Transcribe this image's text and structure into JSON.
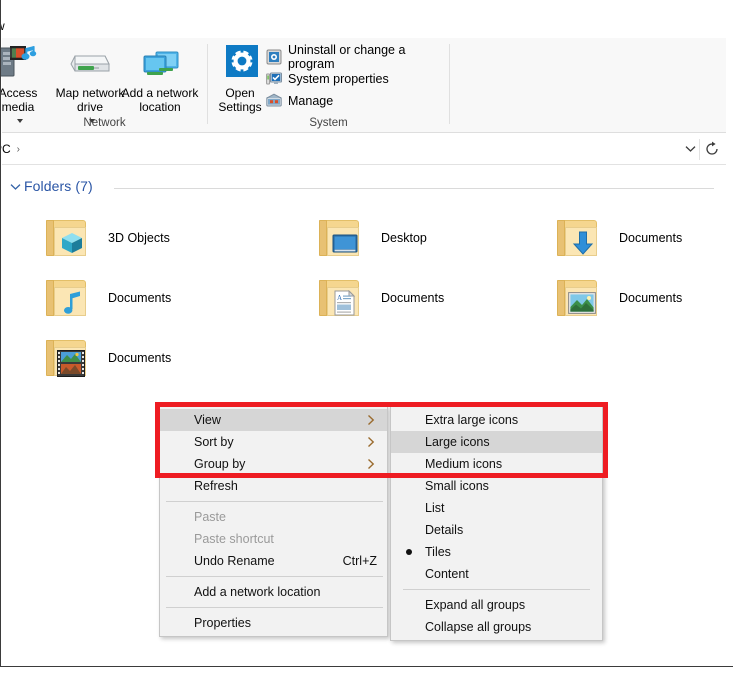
{
  "window": {
    "tab_label": "w"
  },
  "ribbon": {
    "groups": [
      {
        "name": "Network",
        "label": "Network",
        "big_buttons": [
          {
            "icon": "access-media-icon",
            "label": "Access\nmedia",
            "has_dropdown": true
          },
          {
            "icon": "map-network-drive-icon",
            "label": "Map network\ndrive",
            "has_dropdown": true
          },
          {
            "icon": "add-network-location-icon",
            "label": "Add a network\nlocation",
            "has_dropdown": false
          }
        ]
      },
      {
        "name": "System",
        "label": "System",
        "big_buttons": [
          {
            "icon": "open-settings-gear-icon",
            "label": "Open\nSettings",
            "has_dropdown": false
          }
        ],
        "small_commands": [
          {
            "icon": "uninstall-program-icon",
            "label": "Uninstall or change a program"
          },
          {
            "icon": "system-properties-icon",
            "label": "System properties"
          },
          {
            "icon": "manage-icon",
            "label": "Manage"
          }
        ]
      }
    ]
  },
  "address_bar": {
    "breadcrumb": [
      "PC"
    ],
    "separator": "›",
    "dropdown_icon": "chevron-down-icon",
    "refresh_icon": "refresh-icon"
  },
  "content": {
    "group": {
      "chevron": "chevron-down-icon",
      "title": "Folders",
      "count": "(7)"
    },
    "items": [
      {
        "label": "3D Objects",
        "emblem": "3d-cube-emblem"
      },
      {
        "label": "Desktop",
        "emblem": "desktop-monitor-emblem"
      },
      {
        "label": "Documents",
        "emblem": "download-arrow-emblem"
      },
      {
        "label": "Documents",
        "emblem": "music-note-emblem"
      },
      {
        "label": "Documents",
        "emblem": "document-page-emblem"
      },
      {
        "label": "Documents",
        "emblem": "picture-emblem"
      },
      {
        "label": "Documents",
        "emblem": "film-strip-emblem"
      }
    ]
  },
  "context_menu": {
    "items": [
      {
        "label": "View",
        "type": "submenu",
        "highlight": true,
        "disabled": false,
        "accel": ""
      },
      {
        "label": "Sort by",
        "type": "submenu",
        "highlight": false,
        "disabled": false,
        "accel": ""
      },
      {
        "label": "Group by",
        "type": "submenu",
        "highlight": false,
        "disabled": false,
        "accel": ""
      },
      {
        "label": "Refresh",
        "type": "command",
        "highlight": false,
        "disabled": false,
        "accel": ""
      },
      {
        "type": "separator"
      },
      {
        "label": "Paste",
        "type": "command",
        "highlight": false,
        "disabled": true,
        "accel": ""
      },
      {
        "label": "Paste shortcut",
        "type": "command",
        "highlight": false,
        "disabled": true,
        "accel": ""
      },
      {
        "label": "Undo Rename",
        "type": "command",
        "highlight": false,
        "disabled": false,
        "accel": "Ctrl+Z"
      },
      {
        "type": "separator"
      },
      {
        "label": "Add a network location",
        "type": "command",
        "highlight": false,
        "disabled": false,
        "accel": ""
      },
      {
        "type": "separator"
      },
      {
        "label": "Properties",
        "type": "command",
        "highlight": false,
        "disabled": false,
        "accel": ""
      }
    ]
  },
  "view_submenu": {
    "items": [
      {
        "label": "Extra large icons",
        "highlight": false,
        "selected": false
      },
      {
        "label": "Large icons",
        "highlight": true,
        "selected": false
      },
      {
        "label": "Medium icons",
        "highlight": false,
        "selected": false
      },
      {
        "label": "Small icons",
        "highlight": false,
        "selected": false
      },
      {
        "label": "List",
        "highlight": false,
        "selected": false
      },
      {
        "label": "Details",
        "highlight": false,
        "selected": false
      },
      {
        "label": "Tiles",
        "highlight": false,
        "selected": true
      },
      {
        "label": "Content",
        "highlight": false,
        "selected": false
      },
      {
        "type": "separator"
      },
      {
        "label": "Expand all groups",
        "highlight": false,
        "selected": false
      },
      {
        "label": "Collapse all groups",
        "highlight": false,
        "selected": false
      }
    ]
  },
  "annotation": {
    "highlight_color": "#ee1c22",
    "shape": "rectangle"
  },
  "colors": {
    "menu_bg": "#f2f2f2",
    "menu_highlight": "#d6d6d6",
    "group_title": "#2a55a5",
    "accent_blue": "#0078d7"
  }
}
